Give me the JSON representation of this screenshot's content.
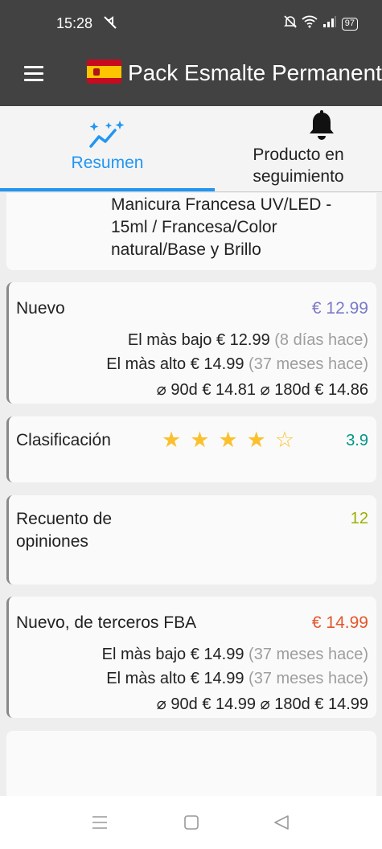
{
  "status_bar": {
    "time": "15:28",
    "battery": "97"
  },
  "app_bar": {
    "title": "Pack Esmalte Permanente"
  },
  "tabs": [
    {
      "label": "Resumen",
      "active": true
    },
    {
      "label": "Producto en seguimiento",
      "active": false
    }
  ],
  "product": {
    "title_fragment": "Manicura Francesa UV/LED - 15ml / Francesa/Color natural/Base y Brillo"
  },
  "new_price": {
    "label": "Nuevo",
    "price": "€ 12.99",
    "lowest_label": "El màs bajo",
    "lowest_value": "€ 12.99",
    "lowest_when": "(8 días hace)",
    "highest_label": "El màs alto",
    "highest_value": "€ 14.99",
    "highest_when": "(37 meses hace)",
    "avg90_label": "⌀ 90d",
    "avg90_value": "€ 14.81",
    "avg180_label": "⌀ 180d",
    "avg180_value": "€ 14.86",
    "color": "#8e8cd8"
  },
  "rating": {
    "label": "Clasificación",
    "value": "3.9",
    "stars_filled": 4,
    "stars_total": 5,
    "color": "#009688"
  },
  "reviews": {
    "label": "Recuento de opiniones",
    "value": "12",
    "color": "#a8c000"
  },
  "fba": {
    "label": "Nuevo, de terceros FBA",
    "price": "€ 14.99",
    "lowest_label": "El màs bajo",
    "lowest_value": "€ 14.99",
    "lowest_when": "(37 meses hace)",
    "highest_label": "El màs alto",
    "highest_value": "€ 14.99",
    "highest_when": "(37 meses hace)",
    "avg90_label": "⌀ 90d",
    "avg90_value": "€ 14.99",
    "avg180_label": "⌀ 180d",
    "avg180_value": "€ 14.99",
    "color": "#e2572c"
  },
  "icons": {
    "menu": "hamburger-icon",
    "flag": "spain-flag-icon",
    "summary": "chart-sparkle-icon",
    "tracking": "bell-icon",
    "nav_recents": "recents-icon",
    "nav_home": "home-icon",
    "nav_back": "back-icon"
  }
}
